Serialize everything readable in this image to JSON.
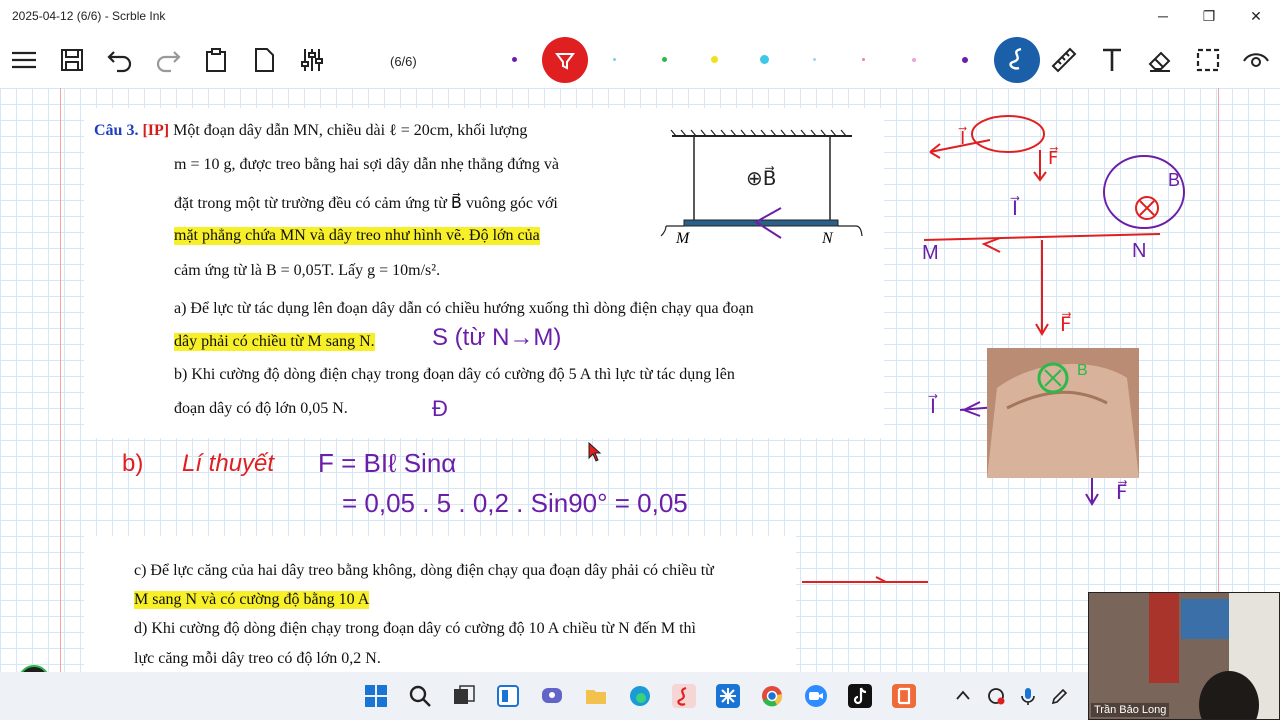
{
  "window": {
    "title": "2025-04-12 (6/6) - Scrble Ink",
    "minimize": "─",
    "restore": "❐",
    "close": "✕"
  },
  "toolbar": {
    "page_indicator": "(6/6)",
    "pen_colors": [
      "#6b1fa8",
      "#e02020",
      "#7ad0f0",
      "#2db84b",
      "#f2e21c",
      "#3cc8e8",
      "#9ad9f0",
      "#ee7fb3",
      "#f0a0d8",
      "#6b1fa8"
    ]
  },
  "document": {
    "q_label": "Câu 3.",
    "q_tag": "[IP]",
    "lines": [
      "Một đoạn dây dẫn MN, chiều dài ℓ = 20cm, khối lượng",
      "m = 10 g, được treo bằng hai sợi dây dẫn nhẹ thẳng đứng và",
      "đặt trong một từ trường đều có cảm ứng từ B⃗ vuông góc với",
      "mặt phẳng chứa MN và dây treo như hình vẽ. Độ lớn của",
      "cảm ứng từ là B = 0,05T. Lấy g = 10m/s².",
      "a) Để lực từ tác dụng lên đoạn dây dẫn có chiều hướng xuống thì dòng điện chạy qua đoạn",
      "dây phải có chiều từ M sang N.",
      "b) Khi cường độ dòng điện chạy trong đoạn dây có cường độ 5 A thì lực từ tác dụng lên",
      "đoạn dây có độ lớn 0,05 N."
    ],
    "lines2": [
      "c) Để lực căng của hai dây treo bằng không, dòng điện chạy qua đoạn dây phải có chiều từ",
      "M sang N và có cường độ bằng 10 A",
      "d) Khi cường độ dòng điện chạy trong đoạn dây có cường độ 10 A chiều từ N đến M thì",
      "lực căng mỗi dây treo có độ lớn 0,2 N."
    ],
    "figure": {
      "label_m": "M",
      "label_n": "N",
      "field_label": "⊕B⃗"
    }
  },
  "handwriting": {
    "answer_a": "S (từ N→M)",
    "answer_b": "Đ",
    "b_label": "b)",
    "b_theory": "Lí thuyết",
    "formula1": "F = BIℓ Sinα",
    "formula2": "= 0,05 . 5 . 0,2 . Sin90° = 0,05",
    "side_m": "M",
    "side_n": "N",
    "side_i": "I⃗",
    "side_f": "F⃗",
    "side_b": "B",
    "thumb_b": "B"
  },
  "webcam": {
    "name": "Trần Bảo Long"
  },
  "taskbar": {
    "apps": [
      "windows",
      "search",
      "task-view",
      "widgets",
      "chat",
      "file-explorer",
      "edge",
      "scrble-ink",
      "app-blue",
      "chrome",
      "zoom",
      "tiktok",
      "scrble"
    ]
  }
}
